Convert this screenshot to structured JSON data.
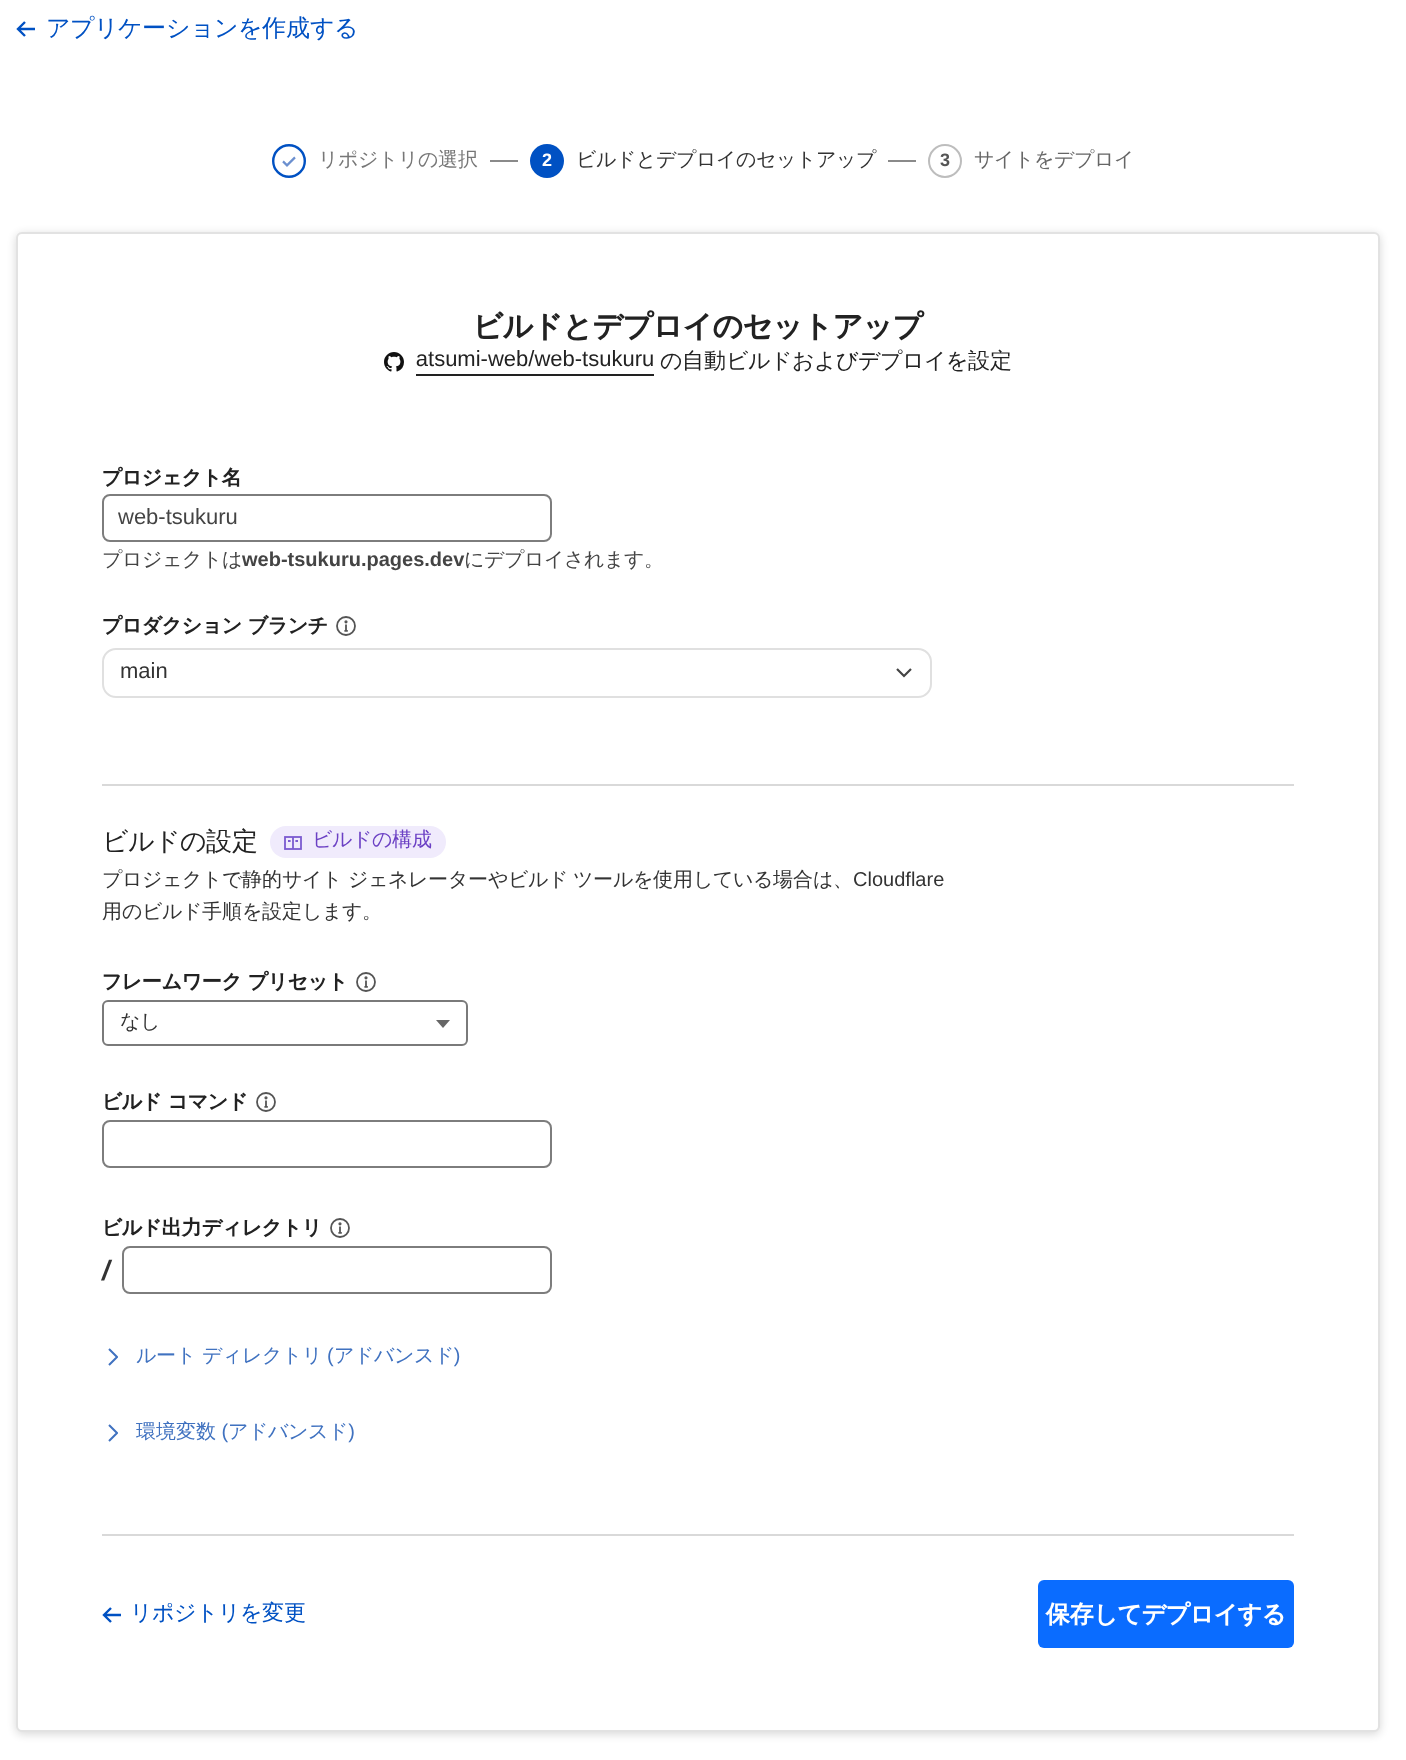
{
  "back_link": {
    "label": "アプリケーションを作成する"
  },
  "steps": [
    {
      "label": "リポジトリの選択",
      "completed": true,
      "selected": false
    },
    {
      "number": "2",
      "label": "ビルドとデプロイのセットアップ",
      "completed": false,
      "selected": true
    },
    {
      "number": "3",
      "label": "サイトをデプロイ",
      "completed": false,
      "selected": false
    }
  ],
  "header": {
    "title": "ビルドとデプロイのセットアップ",
    "repo_link": "atsumi-web/web-tsukuru",
    "subtitle": "の自動ビルドおよびデプロイを設定"
  },
  "project_name": {
    "label": "プロジェクト名",
    "value": "web-tsukuru",
    "helper": "プロジェクトは**web-tsukuru.pages.dev**にデプロイされます。"
  },
  "production_branch": {
    "label": "プロダクション ブランチ",
    "info": true,
    "value": "main"
  },
  "build_settings": {
    "title": "ビルドの設定",
    "badge": "ビルドの構成",
    "description": "プロジェクトで静的サイト ジェネレーターやビルド ツールを使用している場合は、Cloudflare 用のビルド手順を設定します。",
    "fields": [
      {
        "kind": "select",
        "label": "フレームワーク プリセット",
        "info": true,
        "value": "なし"
      },
      {
        "kind": "input",
        "label": "ビルド コマンド",
        "info": true
      },
      {
        "kind": "input",
        "label": "ビルド出力ディレクトリ",
        "info": true,
        "prefix": "/"
      }
    ],
    "sections": [
      {
        "label": "ルート ディレクトリ (アドバンスド)",
        "expanded": false
      },
      {
        "label": "環境変数 (アドバンスド)",
        "expanded": false
      }
    ]
  },
  "footer": {
    "back_link": "リポジトリを変更",
    "primary_button": "保存してデプロイする"
  }
}
